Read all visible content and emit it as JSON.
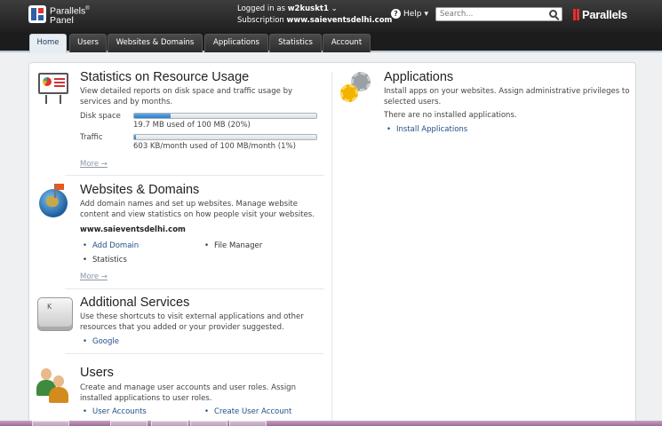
{
  "header": {
    "logo_line1": "Parallels",
    "logo_reg": "®",
    "logo_line2": "Panel",
    "logged_in_label": "Logged in as",
    "username": "w2kuskt1",
    "subscription_label": "Subscription",
    "subscription": "www.saieventsdelhi.com",
    "help_label": "Help",
    "search_placeholder": "Search...",
    "brand": "Parallels",
    "brand_color": "#e42f2f"
  },
  "tabs": [
    {
      "label": "Home",
      "active": true
    },
    {
      "label": "Users",
      "active": false
    },
    {
      "label": "Websites & Domains",
      "active": false
    },
    {
      "label": "Applications",
      "active": false
    },
    {
      "label": "Statistics",
      "active": false
    },
    {
      "label": "Account",
      "active": false
    }
  ],
  "stats": {
    "title": "Statistics on Resource Usage",
    "desc": "View detailed reports on disk space and traffic usage by services and by months.",
    "disk_label": "Disk space",
    "disk_usage": "19.7 MB used of 100 MB (20%)",
    "disk_fraction": 0.2,
    "traffic_label": "Traffic",
    "traffic_usage": "603 KB/month used of 100 MB/month (1%)",
    "traffic_fraction": 0.01,
    "more": "More →"
  },
  "websites": {
    "title": "Websites & Domains",
    "desc": "Add domain names and set up websites. Manage website content and view statistics on how people visit your websites.",
    "domain": "www.saieventsdelhi.com",
    "add_domain": "Add Domain",
    "file_manager": "File Manager",
    "statistics": "Statistics",
    "more": "More →"
  },
  "additional": {
    "title": "Additional Services",
    "desc": "Use these shortcuts to visit external applications and other resources that you added or your provider suggested.",
    "google": "Google",
    "key_letter": "K"
  },
  "users": {
    "title": "Users",
    "desc": "Create and manage user accounts and user roles. Assign installed applications to user roles.",
    "user_accounts": "User Accounts",
    "create_user": "Create User Account"
  },
  "applications": {
    "title": "Applications",
    "desc": "Install apps on your websites. Assign administrative privileges to selected users.",
    "none": "There are no installed applications.",
    "install": "Install Applications"
  },
  "colors": {
    "link": "#1d4f8a",
    "accent_bar": "#2d7bc7"
  }
}
